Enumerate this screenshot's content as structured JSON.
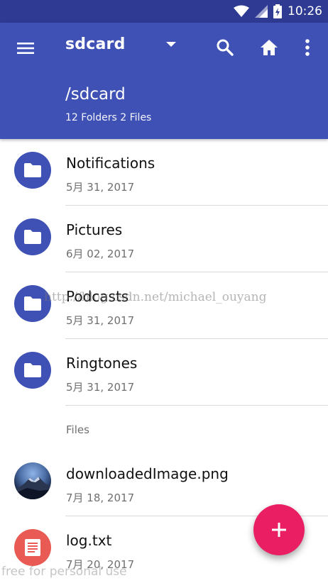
{
  "status_bar": {
    "time": "10:26"
  },
  "toolbar": {
    "dropdown_title": "sdcard",
    "path_title": "/sdcard",
    "path_subtitle": "12 Folders 2 Files"
  },
  "folders": [
    {
      "name": "Notifications",
      "date": "5月 31, 2017"
    },
    {
      "name": "Pictures",
      "date": "6月 02, 2017"
    },
    {
      "name": "Podcasts",
      "date": "5月 31, 2017"
    },
    {
      "name": "Ringtones",
      "date": "5月 31, 2017"
    }
  ],
  "files_section": {
    "header": "Files"
  },
  "files": [
    {
      "name": "downloadedImage.png",
      "date": "7月 18, 2017"
    },
    {
      "name": "log.txt",
      "date": "7月 20, 2017"
    }
  ],
  "watermarks": {
    "center": "http://blog.csdn.net/michael_ouyang",
    "bottom": "free for personal use"
  },
  "colors": {
    "status_bar": "#2f3b93",
    "toolbar": "#3f51b5",
    "folder_avatar": "#3f51b5",
    "fab": "#e91e63",
    "text_doc_avatar": "#e85a53"
  },
  "icons": {
    "menu": "menu-icon",
    "dropdown": "caret-down-icon",
    "search": "search-icon",
    "home": "home-icon",
    "more": "more-vert-icon",
    "folder": "folder-icon",
    "image": "image-thumbnail",
    "text_file": "text-file-icon",
    "fab": "plus-icon"
  }
}
